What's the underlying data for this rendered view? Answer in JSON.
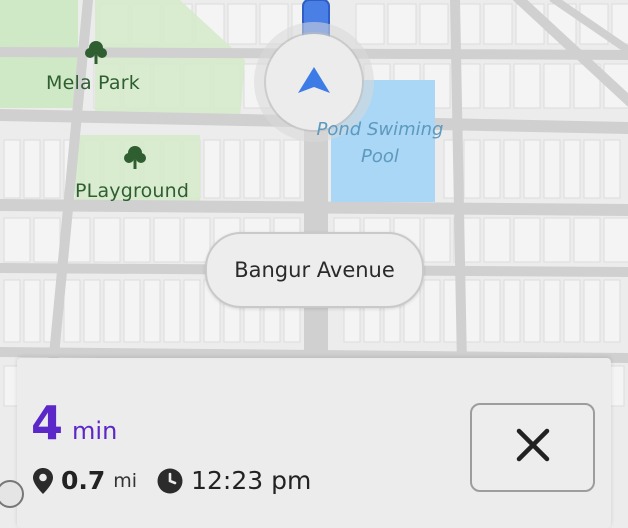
{
  "map": {
    "poi": [
      {
        "name": "Mela Park"
      },
      {
        "name": "PLayground"
      }
    ],
    "pool_label": [
      "Pond Swiming",
      "Pool"
    ],
    "colors": {
      "background": "#ececec",
      "road": "#d3d3d3",
      "block": "#f5f5f5",
      "park": "#cfe8c5",
      "water": "#a9d7f5",
      "route": "#4a7fe6",
      "tree": "#2f5f31"
    }
  },
  "navigation": {
    "street_name": "Bangur Avenue",
    "eta_value": "4",
    "eta_unit": "min",
    "distance_value": "0.7",
    "distance_unit": "mi",
    "arrival_time": "12:23 pm",
    "accent_color": "#5b27c8",
    "icons": {
      "location": "location-pin-icon",
      "clock": "clock-icon",
      "close": "close-icon",
      "navigation": "navigation-arrow-icon"
    }
  }
}
